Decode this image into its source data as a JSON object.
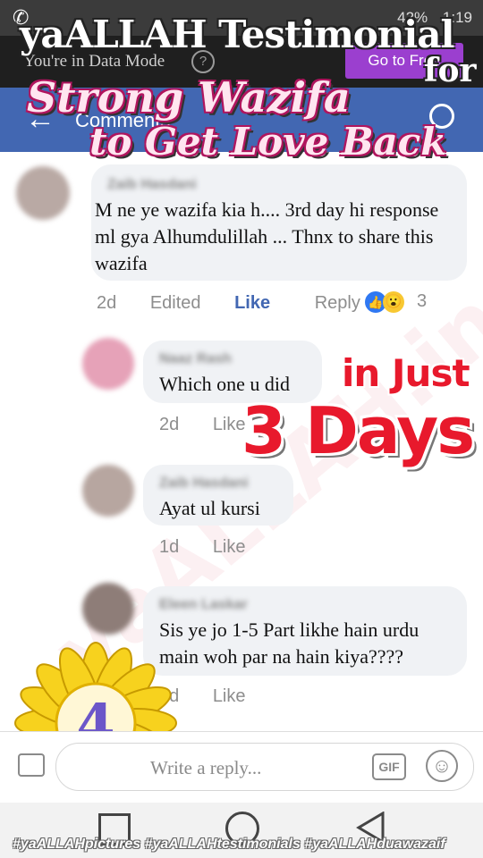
{
  "status_bar": {
    "time": "1:19",
    "battery": "42%"
  },
  "data_bar": {
    "text": "You're in Data Mode",
    "help_icon": "?",
    "free_button": "Go to Free"
  },
  "header": {
    "title": "Comments"
  },
  "overlay": {
    "line1": "yaALLAH Testimonial",
    "for": "for",
    "line2": "Strong Wazifa",
    "line3": "to Get Love Back",
    "just": "in Just",
    "days": "3 Days",
    "sunflower_number": "4",
    "watermark": "yaALLAH.in",
    "hashtags": "#yaALLAHpictures #yaALLAHtestimonials #yaALLAHduawazaif"
  },
  "comments": [
    {
      "author": "Zaib Hasdani",
      "text": "M ne ye wazifa kia h.... 3rd day hi response ml gya Alhumdulillah ... Thnx to share this wazifa",
      "time": "2d",
      "edited": "Edited",
      "like": "Like",
      "reply": "Reply",
      "reaction_count": "3"
    },
    {
      "author": "Naaz Rash",
      "text": "Which one u did",
      "time": "2d",
      "like": "Like"
    },
    {
      "author": "Zaib Hasdani",
      "text": "Ayat ul kursi",
      "time": "1d",
      "like": "Like"
    },
    {
      "author": "Eleen Laskar",
      "text": "Sis ye jo 1-5 Part likhe hain urdu main woh par na hain kiya????",
      "time": "1d",
      "like": "Like"
    }
  ],
  "reply_box": {
    "placeholder": "Write a reply..."
  },
  "colors": {
    "header": "#4267b2",
    "accent_red": "#e8192c",
    "free_button": "#9b3fcf"
  }
}
